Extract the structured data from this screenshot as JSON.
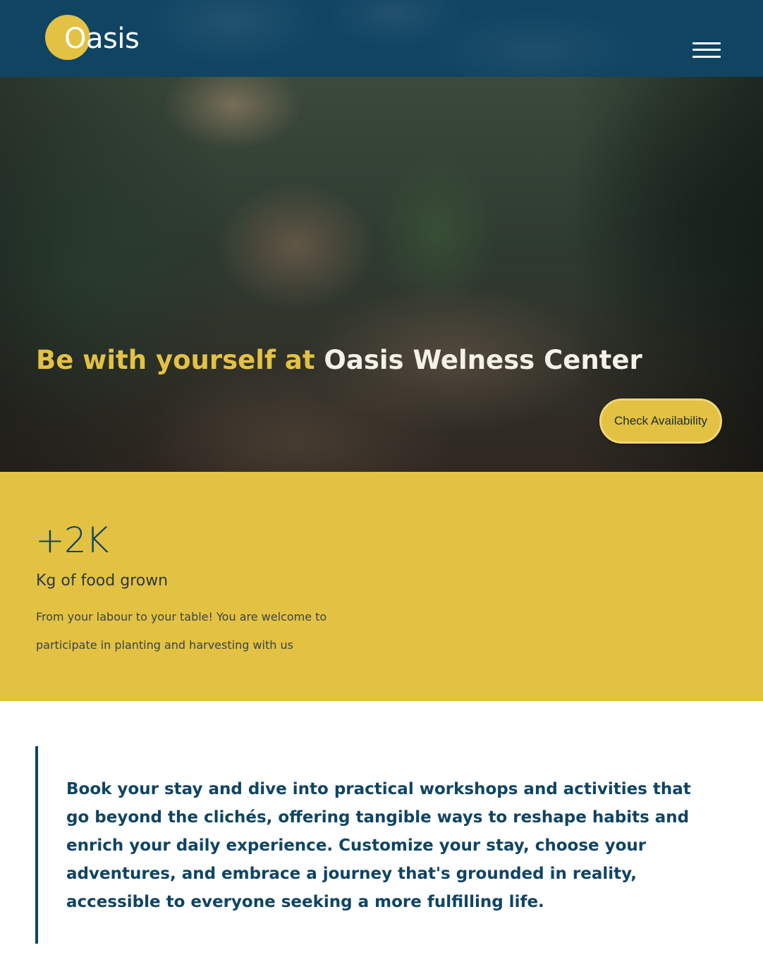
{
  "header": {
    "logo_text": "Oasis",
    "menu_icon": "hamburger-menu-icon",
    "background_color": "#0f4463"
  },
  "hero": {
    "title_accent": "Be with yourself at",
    "title_main": "Oasis Welness Center",
    "cta_label": "Check Availability",
    "accent_color": "#e3c143"
  },
  "stats": {
    "number": "+2K",
    "label": "Kg of food grown",
    "description": "From your labour to your table! You are welcome to participate in planting and harvesting with us",
    "background_color": "#e3c143"
  },
  "quote": {
    "text": "Book your stay and dive into practical workshops and activities that go beyond the clichés, offering tangible ways to reshape habits and enrich your daily experience. Customize your stay, choose your adventures, and embrace a journey that's grounded in reality, accessible to everyone seeking a more fulfilling life.",
    "color": "#0f4463"
  }
}
